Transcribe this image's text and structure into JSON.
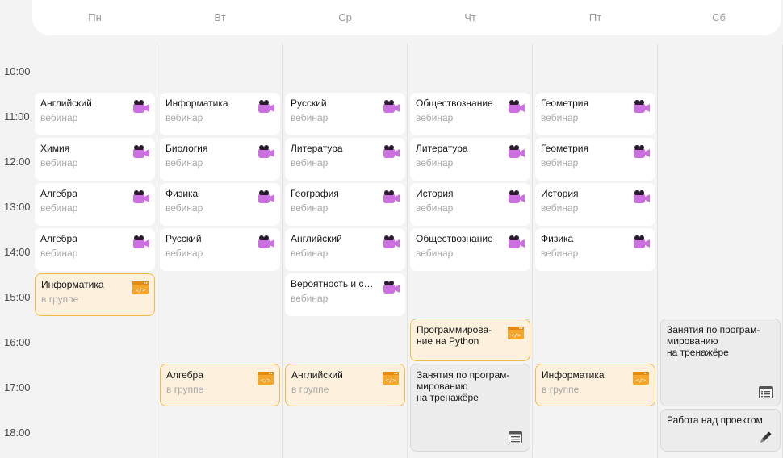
{
  "days": [
    "Пн",
    "Вт",
    "Ср",
    "Чт",
    "Пт",
    "Сб"
  ],
  "times": [
    "10:00",
    "11:00",
    "12:00",
    "13:00",
    "14:00",
    "15:00",
    "16:00",
    "17:00",
    "18:00"
  ],
  "events": [
    {
      "day": 0,
      "slot": 1,
      "span": 1,
      "title": "Английский",
      "sub": "вебинар",
      "kind": "webinar"
    },
    {
      "day": 0,
      "slot": 2,
      "span": 1,
      "title": "Химия",
      "sub": "вебинар",
      "kind": "webinar"
    },
    {
      "day": 0,
      "slot": 3,
      "span": 1,
      "title": "Алгебра",
      "sub": "вебинар",
      "kind": "webinar"
    },
    {
      "day": 0,
      "slot": 4,
      "span": 1,
      "title": "Алгебра",
      "sub": "вебинар",
      "kind": "webinar"
    },
    {
      "day": 0,
      "slot": 5,
      "span": 1,
      "title": "Информатика",
      "sub": "в группе",
      "kind": "group"
    },
    {
      "day": 1,
      "slot": 1,
      "span": 1,
      "title": "Информатика",
      "sub": "вебинар",
      "kind": "webinar"
    },
    {
      "day": 1,
      "slot": 2,
      "span": 1,
      "title": "Биология",
      "sub": "вебинар",
      "kind": "webinar"
    },
    {
      "day": 1,
      "slot": 3,
      "span": 1,
      "title": "Физика",
      "sub": "вебинар",
      "kind": "webinar"
    },
    {
      "day": 1,
      "slot": 4,
      "span": 1,
      "title": "Русский",
      "sub": "вебинар",
      "kind": "webinar"
    },
    {
      "day": 1,
      "slot": 7,
      "span": 1,
      "title": "Алгебра",
      "sub": "в группе",
      "kind": "group"
    },
    {
      "day": 2,
      "slot": 1,
      "span": 1,
      "title": "Русский",
      "sub": "вебинар",
      "kind": "webinar"
    },
    {
      "day": 2,
      "slot": 2,
      "span": 1,
      "title": "Литература",
      "sub": "вебинар",
      "kind": "webinar"
    },
    {
      "day": 2,
      "slot": 3,
      "span": 1,
      "title": "География",
      "sub": "вебинар",
      "kind": "webinar"
    },
    {
      "day": 2,
      "slot": 4,
      "span": 1,
      "title": "Английский",
      "sub": "вебинар",
      "kind": "webinar"
    },
    {
      "day": 2,
      "slot": 5,
      "span": 1,
      "title": "Вероятность и с…",
      "sub": "вебинар",
      "kind": "webinar"
    },
    {
      "day": 2,
      "slot": 7,
      "span": 1,
      "title": "Английский",
      "sub": "в группе",
      "kind": "group"
    },
    {
      "day": 3,
      "slot": 1,
      "span": 1,
      "title": "Обществознание",
      "sub": "вебинар",
      "kind": "webinar"
    },
    {
      "day": 3,
      "slot": 2,
      "span": 1,
      "title": "Литература",
      "sub": "вебинар",
      "kind": "webinar"
    },
    {
      "day": 3,
      "slot": 3,
      "span": 1,
      "title": "История",
      "sub": "вебинар",
      "kind": "webinar"
    },
    {
      "day": 3,
      "slot": 4,
      "span": 1,
      "title": "Обществознание",
      "sub": "вебинар",
      "kind": "webinar"
    },
    {
      "day": 3,
      "slot": 6,
      "span": 1,
      "title": "Программирова-\nние на Python",
      "sub": "",
      "kind": "group"
    },
    {
      "day": 3,
      "slot": 7,
      "span": 2,
      "title": "Занятия по програм-\nмированию\nна тренажёре",
      "sub": "",
      "kind": "trainer"
    },
    {
      "day": 4,
      "slot": 1,
      "span": 1,
      "title": "Геометрия",
      "sub": "вебинар",
      "kind": "webinar"
    },
    {
      "day": 4,
      "slot": 2,
      "span": 1,
      "title": "Геометрия",
      "sub": "вебинар",
      "kind": "webinar"
    },
    {
      "day": 4,
      "slot": 3,
      "span": 1,
      "title": "История",
      "sub": "вебинар",
      "kind": "webinar"
    },
    {
      "day": 4,
      "slot": 4,
      "span": 1,
      "title": "Физика",
      "sub": "вебинар",
      "kind": "webinar"
    },
    {
      "day": 4,
      "slot": 7,
      "span": 1,
      "title": "Информатика",
      "sub": "в группе",
      "kind": "group"
    },
    {
      "day": 5,
      "slot": 6,
      "span": 2,
      "title": "Занятия по програм-\nмированию\nна тренажёре",
      "sub": "",
      "kind": "trainer"
    },
    {
      "day": 5,
      "slot": 8,
      "span": 1,
      "title": "Работа над проектом",
      "sub": "",
      "kind": "project"
    }
  ]
}
